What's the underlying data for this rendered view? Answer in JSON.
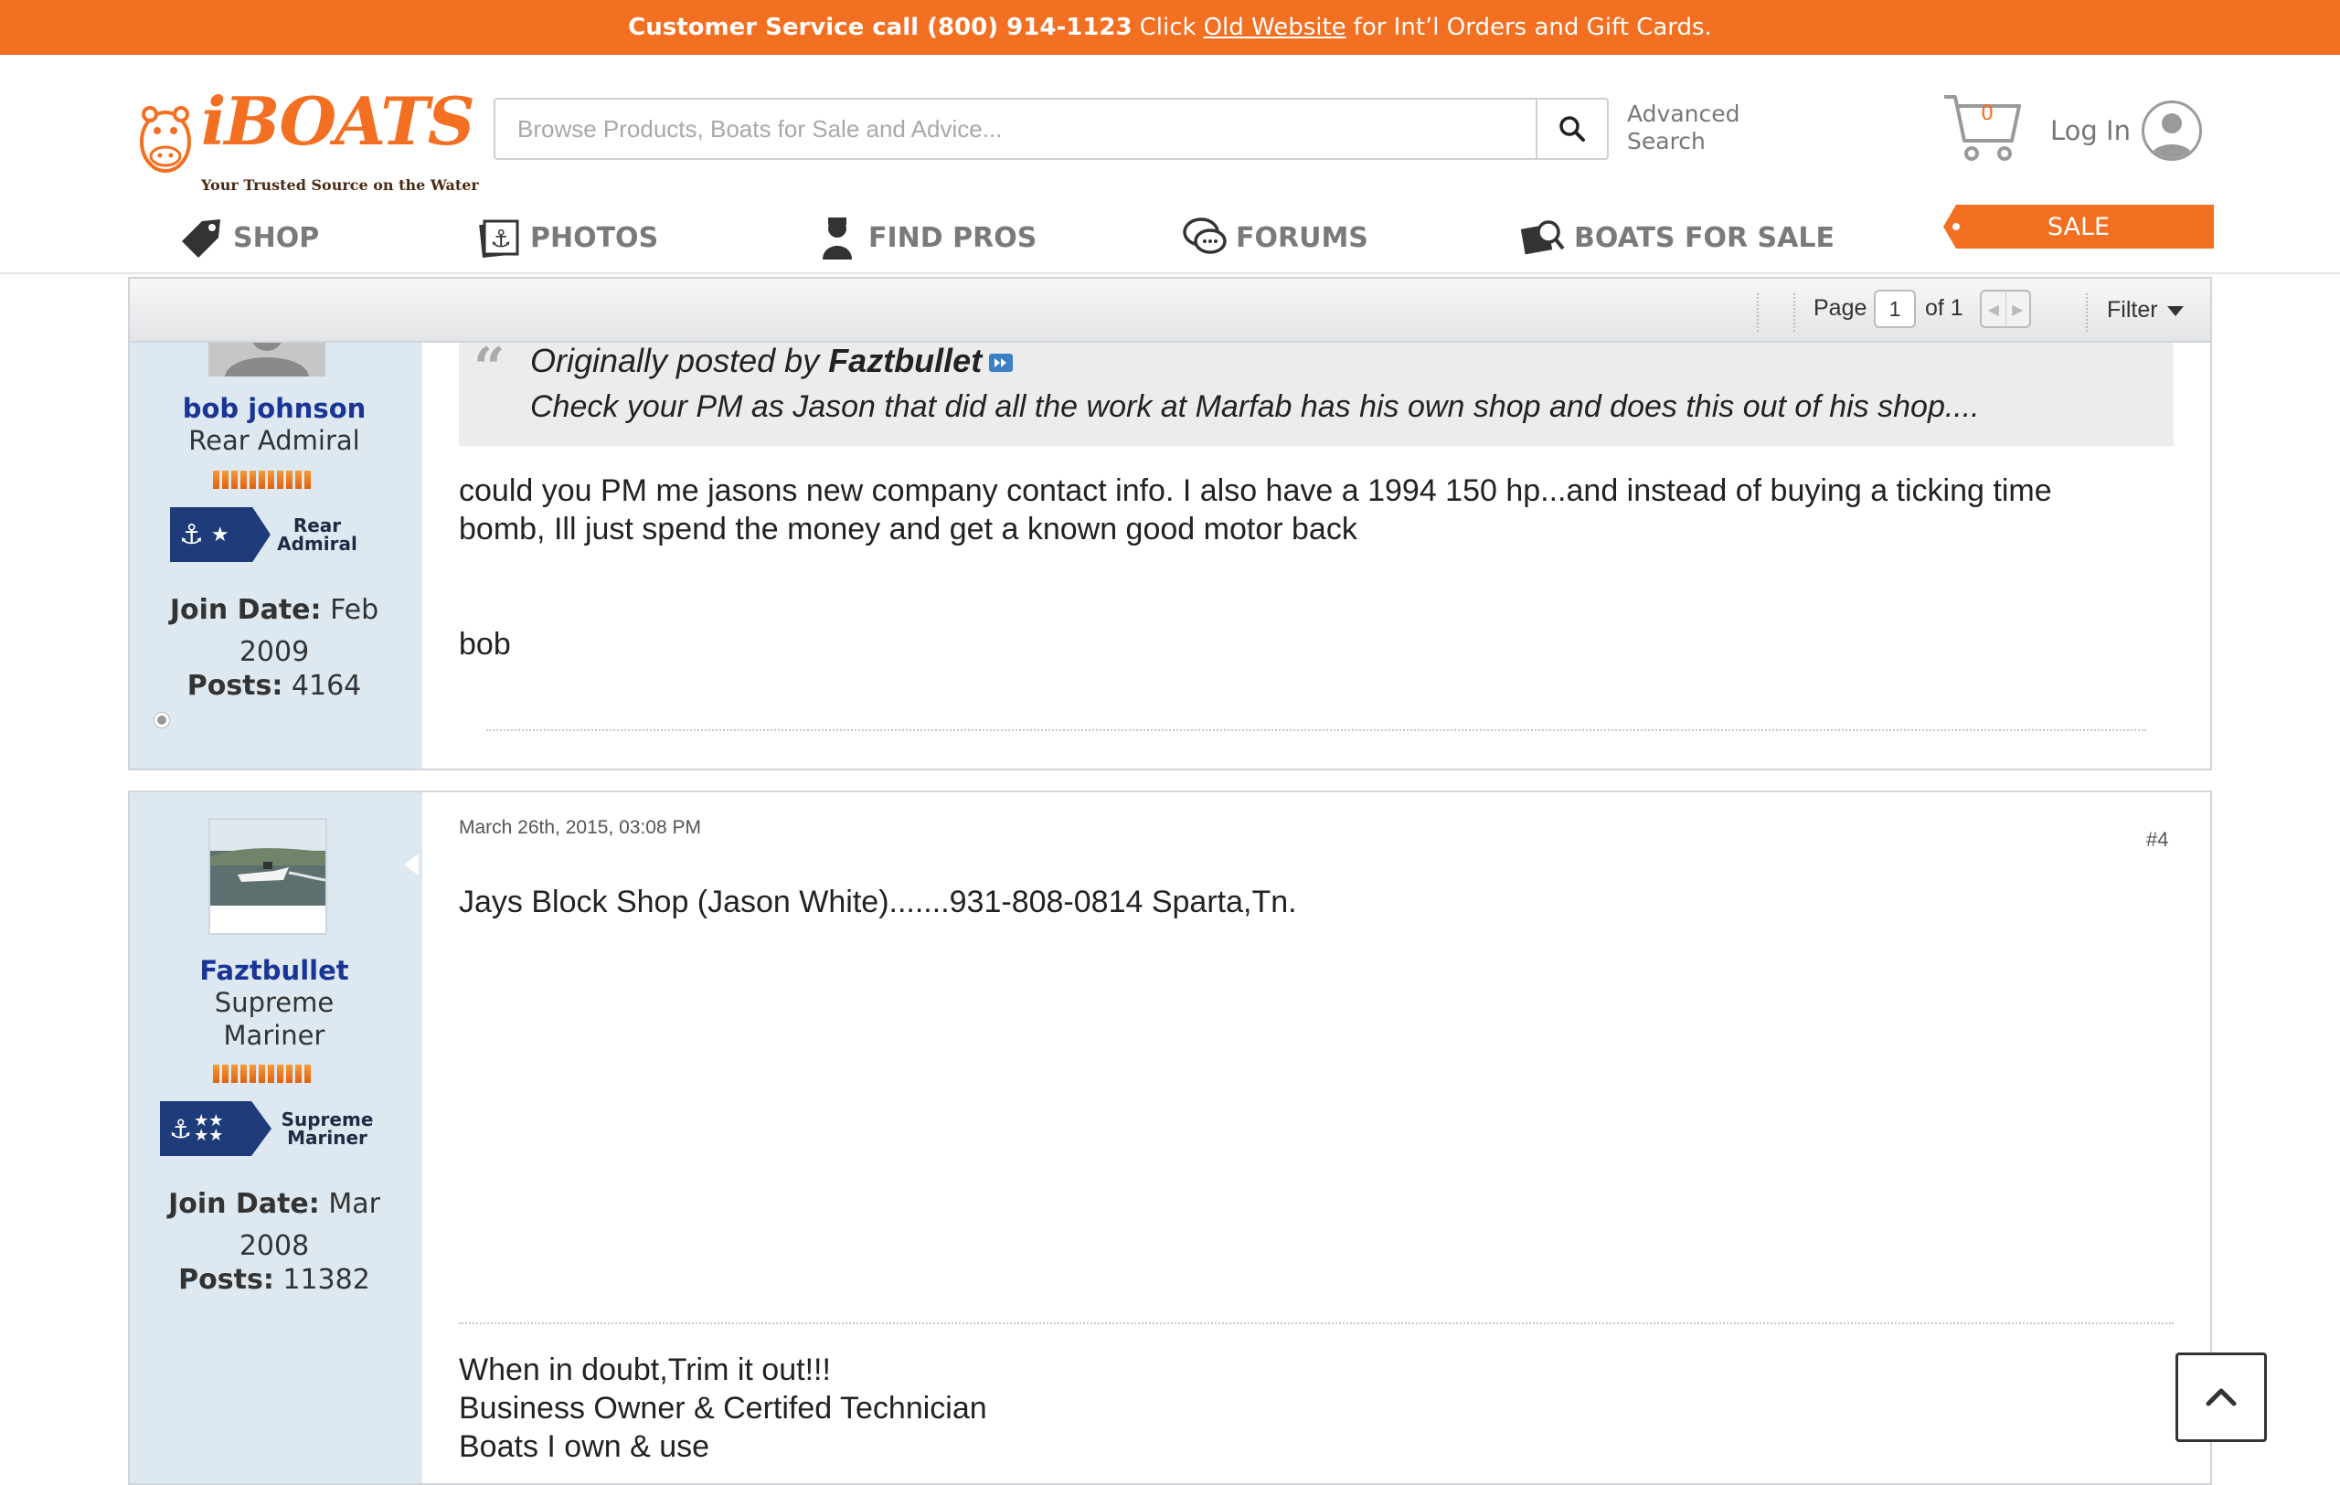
{
  "topbar": {
    "service_label": "Customer Service call (800) 914-1123",
    "click_text": "Click",
    "link_text": "Old Website",
    "rest_text": "for Int’l Orders and Gift Cards."
  },
  "header": {
    "logo_text": "iBOATS",
    "logo_tagline": "Your Trusted Source on the Water",
    "search_placeholder": "Browse Products, Boats for Sale and Advice...",
    "advanced_search": "Advanced Search",
    "cart_count": "0",
    "login_label": "Log In"
  },
  "nav": {
    "items": [
      {
        "label": "SHOP",
        "icon": "tag-icon"
      },
      {
        "label": "PHOTOS",
        "icon": "photos-icon"
      },
      {
        "label": "FIND PROS",
        "icon": "mechanic-icon"
      },
      {
        "label": "FORUMS",
        "icon": "chat-bubbles-icon"
      },
      {
        "label": "BOATS FOR SALE",
        "icon": "boat-search-icon"
      }
    ],
    "sale_label": "SALE"
  },
  "pagination": {
    "page_label": "Page",
    "current_page": "1",
    "of_label": "of 1",
    "filter_label": "Filter"
  },
  "posts": [
    {
      "username": "bob johnson",
      "rank": "Rear Admiral",
      "badge_label": "Rear Admiral",
      "join_label": "Join Date:",
      "join_month": "Feb",
      "join_year": "2009",
      "posts_label": "Posts:",
      "posts_count": "4164",
      "quote_prefix": "Originally posted by",
      "quote_author": "Faztbullet",
      "quote_text": "Check your PM as Jason that did all the work at Marfab has his own shop and does this out of his shop....",
      "body_line1": "could you PM me jasons new company contact info. I also have a 1994 150 hp...and instead of buying a ticking time",
      "body_line2": "bomb, Ill just spend the money and get a known good motor back",
      "signature": "bob"
    },
    {
      "username": "Faztbullet",
      "rank_line1": "Supreme",
      "rank_line2": "Mariner",
      "badge_label": "Supreme Mariner",
      "join_label": "Join Date:",
      "join_month": "Mar",
      "join_year": "2008",
      "posts_label": "Posts:",
      "posts_count": "11382",
      "date": "March 26th, 2015, 03:08 PM",
      "post_number": "#4",
      "body": "Jays Block Shop (Jason White).......931-808-0814 Sparta,Tn.",
      "signature_line1": "When in doubt,Trim it out!!!",
      "signature_line2": "Business Owner & Certifed Technician",
      "signature_line3": "Boats I own & use"
    }
  ],
  "colors": {
    "brand_orange": "#f36f21",
    "username_blue": "#1a3596",
    "sidebar_bg": "#dde8f1",
    "badge_navy": "#1f3c7a"
  }
}
